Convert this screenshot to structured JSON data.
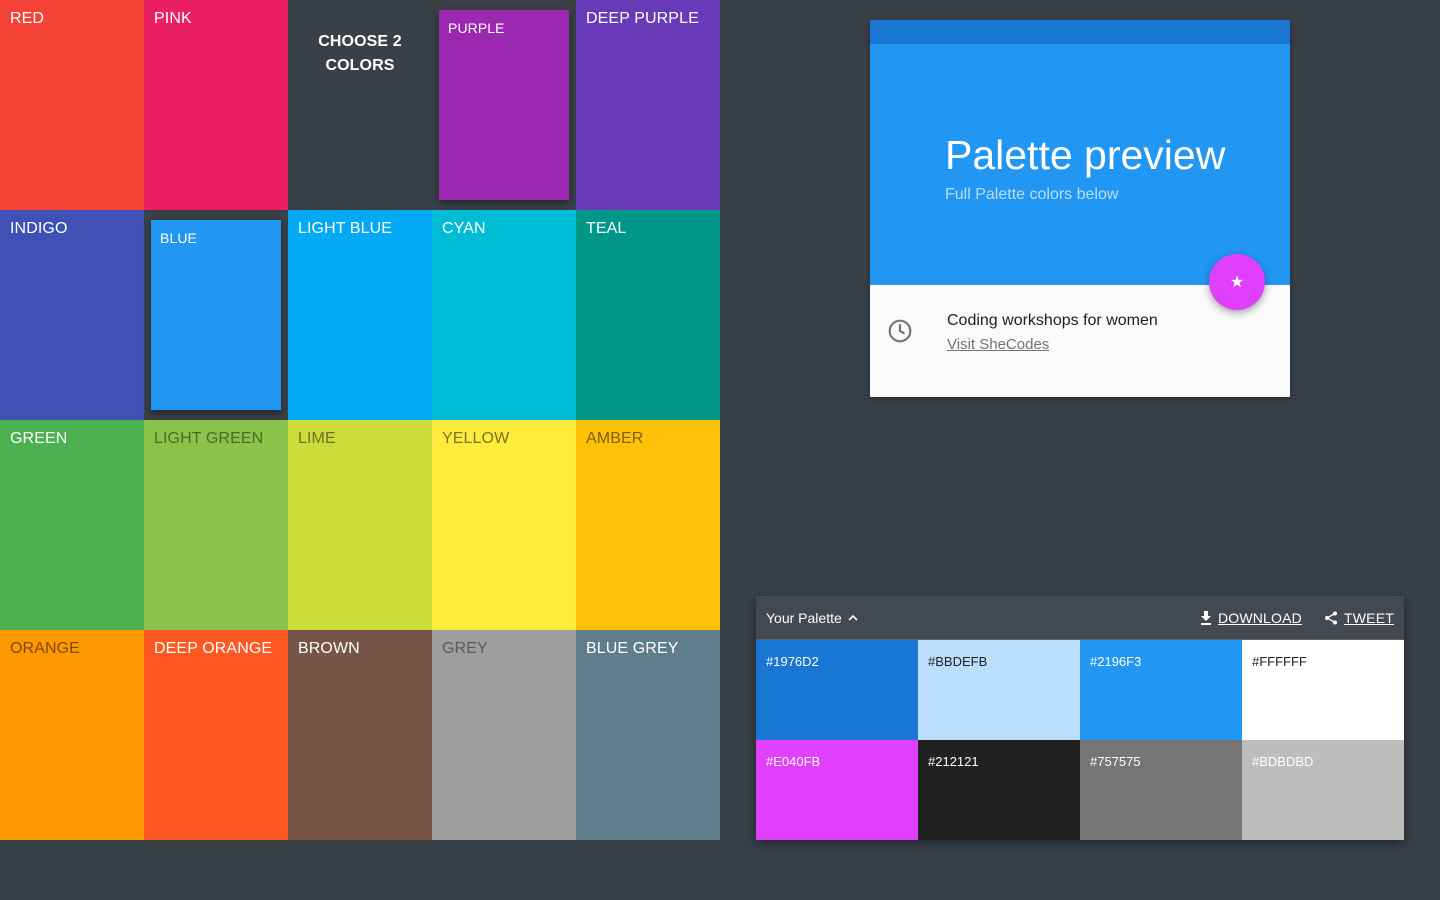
{
  "grid": {
    "heading": "CHOOSE 2 COLORS",
    "tiles": [
      {
        "label": "RED",
        "color": "#F44336",
        "text": "#FFFFFF"
      },
      {
        "label": "PINK",
        "color": "#E91E63",
        "text": "#FFFFFF"
      },
      {
        "label": "",
        "color": "#394048",
        "text": "#FFFFFF"
      },
      {
        "label": "PURPLE",
        "color": "#9C27B0",
        "text": "#FFFFFF"
      },
      {
        "label": "DEEP PURPLE",
        "color": "#673AB7",
        "text": "#FFFFFF"
      },
      {
        "label": "INDIGO",
        "color": "#3F51B5",
        "text": "#FFFFFF"
      },
      {
        "label": "BLUE",
        "color": "#2196F3",
        "text": "#FFFFFF"
      },
      {
        "label": "LIGHT BLUE",
        "color": "#03A9F4",
        "text": "#FFFFFF"
      },
      {
        "label": "CYAN",
        "color": "#00BCD4",
        "text": "#FFFFFF"
      },
      {
        "label": "TEAL",
        "color": "#009688",
        "text": "#FFFFFF"
      },
      {
        "label": "GREEN",
        "color": "#4CAF50",
        "text": "#FFFFFF"
      },
      {
        "label": "LIGHT GREEN",
        "color": "#8BC34A",
        "text": "#4a6a2a"
      },
      {
        "label": "LIME",
        "color": "#CDDC39",
        "text": "#6a7220"
      },
      {
        "label": "YELLOW",
        "color": "#FFEB3B",
        "text": "#7c7420"
      },
      {
        "label": "AMBER",
        "color": "#FFC107",
        "text": "#7c5f10"
      },
      {
        "label": "ORANGE",
        "color": "#FF9800",
        "text": "#7c4a10"
      },
      {
        "label": "DEEP ORANGE",
        "color": "#FF5722",
        "text": "#FFFFFF"
      },
      {
        "label": "BROWN",
        "color": "#795548",
        "text": "#FFFFFF"
      },
      {
        "label": "GREY",
        "color": "#9E9E9E",
        "text": "#5a5a5a"
      },
      {
        "label": "BLUE GREY",
        "color": "#607D8B",
        "text": "#FFFFFF"
      }
    ]
  },
  "preview": {
    "title": "Palette preview",
    "subtitle": "Full Palette colors below",
    "fab_icon": "star-icon",
    "fab_glyph": "★",
    "body_title": "Coding workshops for women",
    "body_link": "Visit SheCodes",
    "clock_icon": "clock-icon"
  },
  "palette": {
    "title": "Your Palette",
    "download_label": "DOWNLOAD",
    "tweet_label": "TWEET",
    "swatches": [
      {
        "hex": "#1976D2",
        "text": "#FFFFFF"
      },
      {
        "hex": "#BBDEFB",
        "text": "#212121"
      },
      {
        "hex": "#2196F3",
        "text": "#FFFFFF"
      },
      {
        "hex": "#FFFFFF",
        "text": "#212121"
      },
      {
        "hex": "#E040FB",
        "text": "#FFFFFF"
      },
      {
        "hex": "#212121",
        "text": "#FFFFFF"
      },
      {
        "hex": "#757575",
        "text": "#FFFFFF"
      },
      {
        "hex": "#BDBDBD",
        "text": "#FFFFFF"
      }
    ]
  }
}
